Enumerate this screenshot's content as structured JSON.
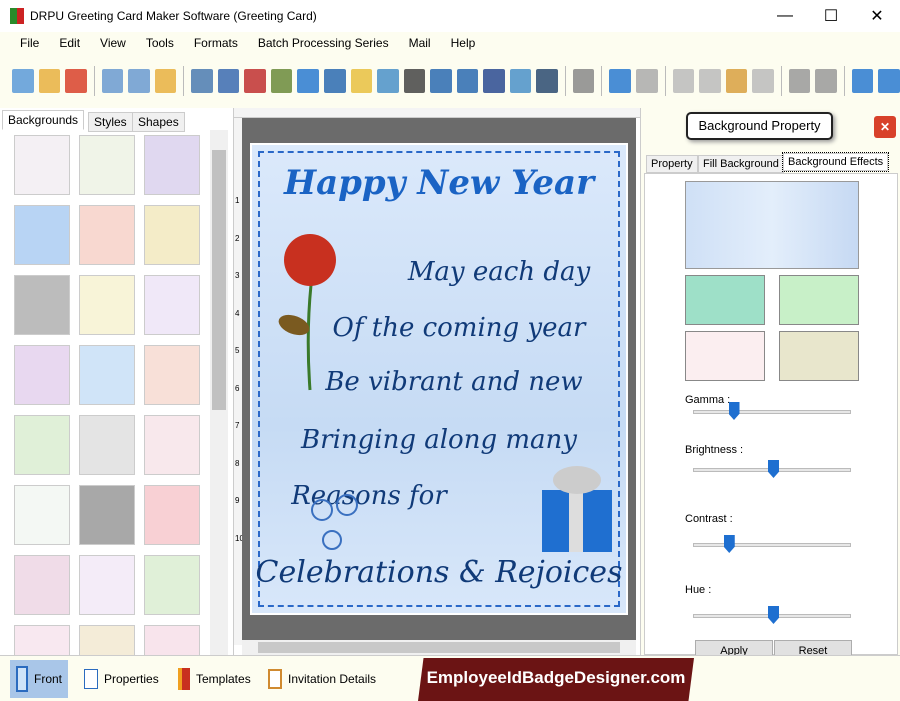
{
  "window": {
    "title": "DRPU Greeting Card Maker Software (Greeting Card)",
    "minimize": "—",
    "maximize": "☐",
    "close": "✕"
  },
  "menu": [
    "File",
    "Edit",
    "View",
    "Tools",
    "Formats",
    "Batch Processing Series",
    "Mail",
    "Help"
  ],
  "toolbar_icons": [
    "new",
    "open",
    "close",
    "save",
    "save-as",
    "export",
    "properties",
    "print",
    "layers",
    "image-crop",
    "insert-image",
    "pen",
    "shapes",
    "watermark",
    "barcode",
    "text",
    "word-art",
    "signature",
    "email",
    "line",
    "database",
    "undo",
    "redo",
    "cut",
    "copy",
    "paste",
    "delete",
    "bring-front",
    "send-back",
    "grid",
    "actual-size"
  ],
  "left_panel": {
    "tabs": [
      "Backgrounds",
      "Styles",
      "Shapes"
    ],
    "active_tab": "Backgrounds"
  },
  "ruler_numbers": [
    "1",
    "2",
    "3",
    "4",
    "5",
    "6",
    "7",
    "8",
    "9",
    "10"
  ],
  "card": {
    "title": "Happy New Year",
    "lines": [
      "May each day",
      "Of the coming year",
      "Be vibrant and new",
      "Bringing along many",
      "Reasons for"
    ],
    "footer": "Celebrations & Rejoices"
  },
  "right_panel": {
    "header": "Background Property",
    "tabs": [
      "Property",
      "Fill Background",
      "Background Effects"
    ],
    "active_tab": "Background Effects",
    "sliders": [
      {
        "label": "Gamma :",
        "value": 0.25
      },
      {
        "label": "Brightness :",
        "value": 0.5
      },
      {
        "label": "Contrast :",
        "value": 0.22
      },
      {
        "label": "Hue :",
        "value": 0.5
      }
    ],
    "apply": "Apply",
    "reset": "Reset"
  },
  "bottom": {
    "tabs": [
      "Front",
      "Properties",
      "Templates",
      "Invitation Details"
    ],
    "active": "Front",
    "brand": "EmployeeIdBadgeDesigner.com"
  }
}
